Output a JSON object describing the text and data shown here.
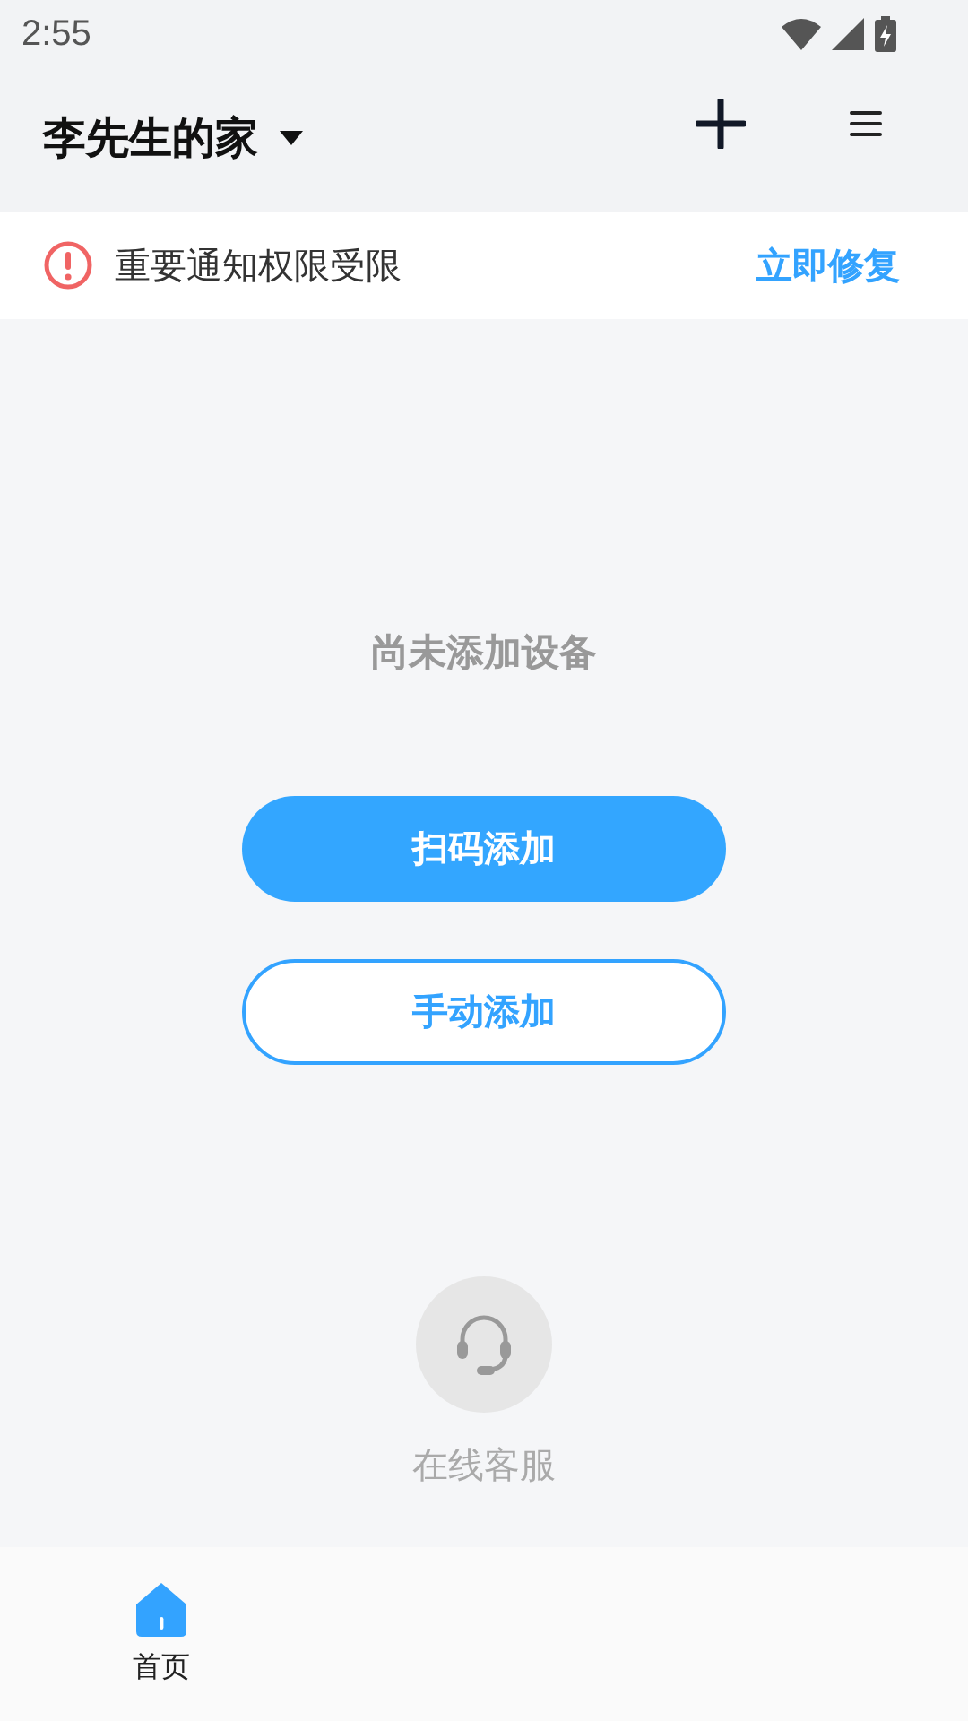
{
  "status_bar": {
    "time": "2:55"
  },
  "header": {
    "title": "李先生的家"
  },
  "notice": {
    "text": "重要通知权限受限",
    "action": "立即修复"
  },
  "empty": {
    "message": "尚未添加设备"
  },
  "buttons": [
    {
      "label": "扫码添加",
      "kind": "primary"
    },
    {
      "label": "手动添加",
      "kind": "outline"
    }
  ],
  "support": {
    "label": "在线客服"
  },
  "tab_bar": {
    "tabs": [
      {
        "label": "首页",
        "selected": true
      }
    ]
  }
}
